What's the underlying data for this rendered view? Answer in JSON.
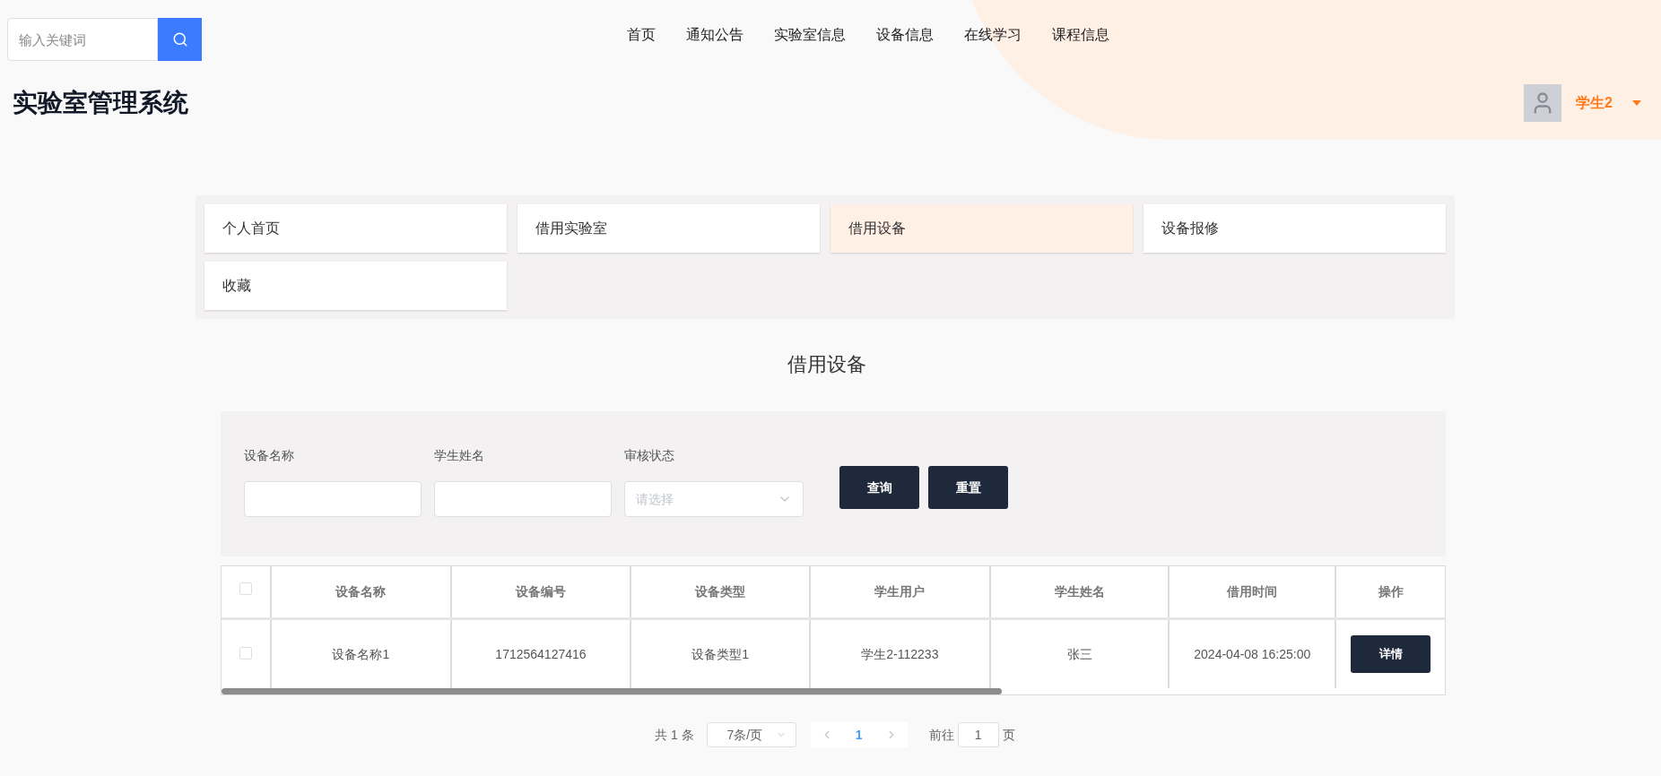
{
  "search": {
    "placeholder": "输入关键词"
  },
  "nav": [
    "首页",
    "通知公告",
    "实验室信息",
    "设备信息",
    "在线学习",
    "课程信息"
  ],
  "site_title": "实验室管理系统",
  "user": {
    "name": "学生2"
  },
  "menu": [
    {
      "label": "个人首页",
      "selected": false
    },
    {
      "label": "借用实验室",
      "selected": false
    },
    {
      "label": "借用设备",
      "selected": true
    },
    {
      "label": "设备报修",
      "selected": false
    },
    {
      "label": "收藏",
      "selected": false
    }
  ],
  "page_title": "借用设备",
  "filters": [
    {
      "kind": "input",
      "label": "设备名称"
    },
    {
      "kind": "input",
      "label": "学生姓名"
    },
    {
      "kind": "select",
      "label": "审核状态",
      "placeholder": "请选择"
    }
  ],
  "filter_buttons": [
    "查询",
    "重置"
  ],
  "table": {
    "header_checked": false,
    "columns": [
      "设备名称",
      "设备编号",
      "设备类型",
      "学生用户",
      "学生姓名",
      "借用时间",
      "操作"
    ],
    "rows": [
      {
        "checked": false,
        "cells": [
          "设备名称1",
          "1712564127416",
          "设备类型1",
          "学生2-112233",
          "张三",
          "2024-04-08 16:25:00"
        ],
        "action": "详情"
      }
    ]
  },
  "pagination": {
    "total": "共 1 条",
    "page_size": "7条/页",
    "pages": [
      {
        "label": "1",
        "selected": true
      }
    ],
    "goto_label": "前往",
    "goto_value": "1",
    "goto_suffix": "页"
  }
}
